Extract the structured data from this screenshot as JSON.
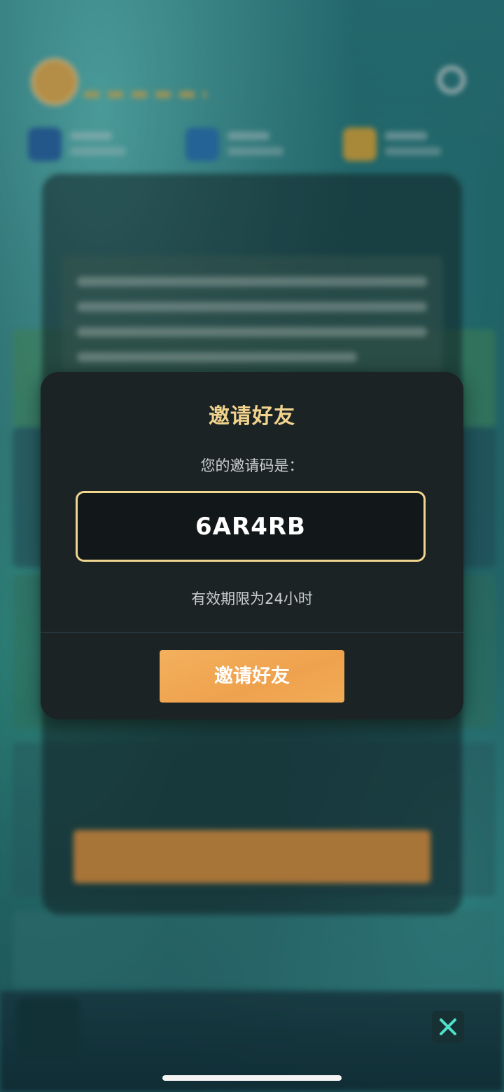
{
  "dialog": {
    "title": "邀请好友",
    "prompt": "您的邀请码是：",
    "invite_code": "6AR4RB",
    "validity": "有效期限为24小时",
    "button_label": "邀请好友"
  },
  "colors": {
    "accent_gold": "#f2d38d",
    "button_orange": "#efa24d",
    "dialog_bg": "#1b2325",
    "close_icon": "#4fe0c8"
  },
  "icons": {
    "close": "close-icon",
    "settings": "gear-icon"
  }
}
